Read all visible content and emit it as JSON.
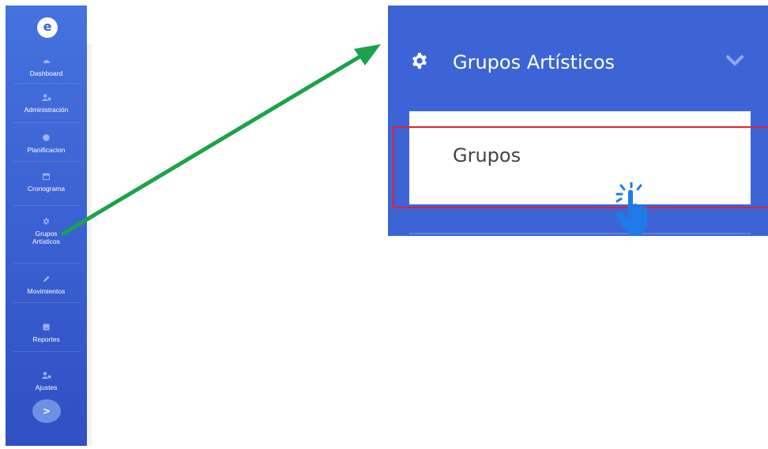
{
  "sidebar": {
    "logo_glyph": "е",
    "items": [
      {
        "label": "Dashboard",
        "icon": "speedometer-icon"
      },
      {
        "label": "Administración",
        "icon": "users-icon"
      },
      {
        "label": "Planificacion",
        "icon": "circle-icon"
      },
      {
        "label": "Cronograma",
        "icon": "calendar-icon"
      },
      {
        "label": "Grupos\nArtísticos",
        "icon": "gear-icon"
      },
      {
        "label": "Movimientos",
        "icon": "pencil-icon"
      },
      {
        "label": "Reportes",
        "icon": "report-icon"
      },
      {
        "label": "Ajustes",
        "icon": "user-settings-icon"
      }
    ],
    "toggle_glyph": ">"
  },
  "zoom": {
    "menu_label": "Grupos Artísticos",
    "submenu_item": "Grupos"
  },
  "colors": {
    "sidebar": "#3b63d3",
    "arrow": "#1aa34a",
    "highlight": "#e0212b",
    "cursor": "#1e7be8"
  }
}
